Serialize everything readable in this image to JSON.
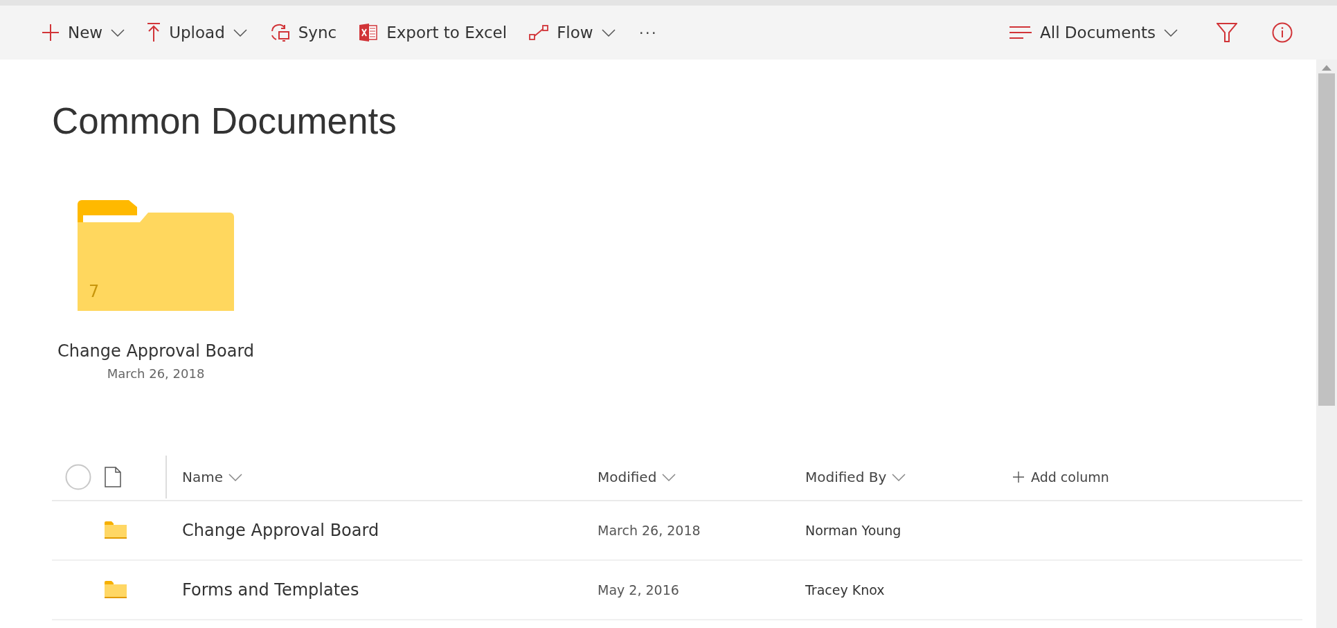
{
  "toolbar": {
    "commands": [
      {
        "label": "New",
        "dropdown": true
      },
      {
        "label": "Upload",
        "dropdown": true
      },
      {
        "label": "Sync",
        "dropdown": false
      },
      {
        "label": "Export to Excel",
        "dropdown": false
      },
      {
        "label": "Flow",
        "dropdown": true
      }
    ],
    "more": "···",
    "view": {
      "label": "All Documents",
      "dropdown": true
    }
  },
  "page_title": "Common Documents",
  "tiles": [
    {
      "name": "Change Approval Board",
      "date": "March 26, 2018",
      "count": "7"
    }
  ],
  "table": {
    "columns": [
      {
        "label": "Name",
        "sortable": true
      },
      {
        "label": "Modified",
        "sortable": true
      },
      {
        "label": "Modified By",
        "sortable": true
      }
    ],
    "add_column": "Add column",
    "rows": [
      {
        "name": "Change Approval Board",
        "modified": "March 26, 2018",
        "modified_by": "Norman Young"
      },
      {
        "name": "Forms and Templates",
        "modified": "May 2, 2016",
        "modified_by": "Tracey Knox"
      }
    ]
  }
}
